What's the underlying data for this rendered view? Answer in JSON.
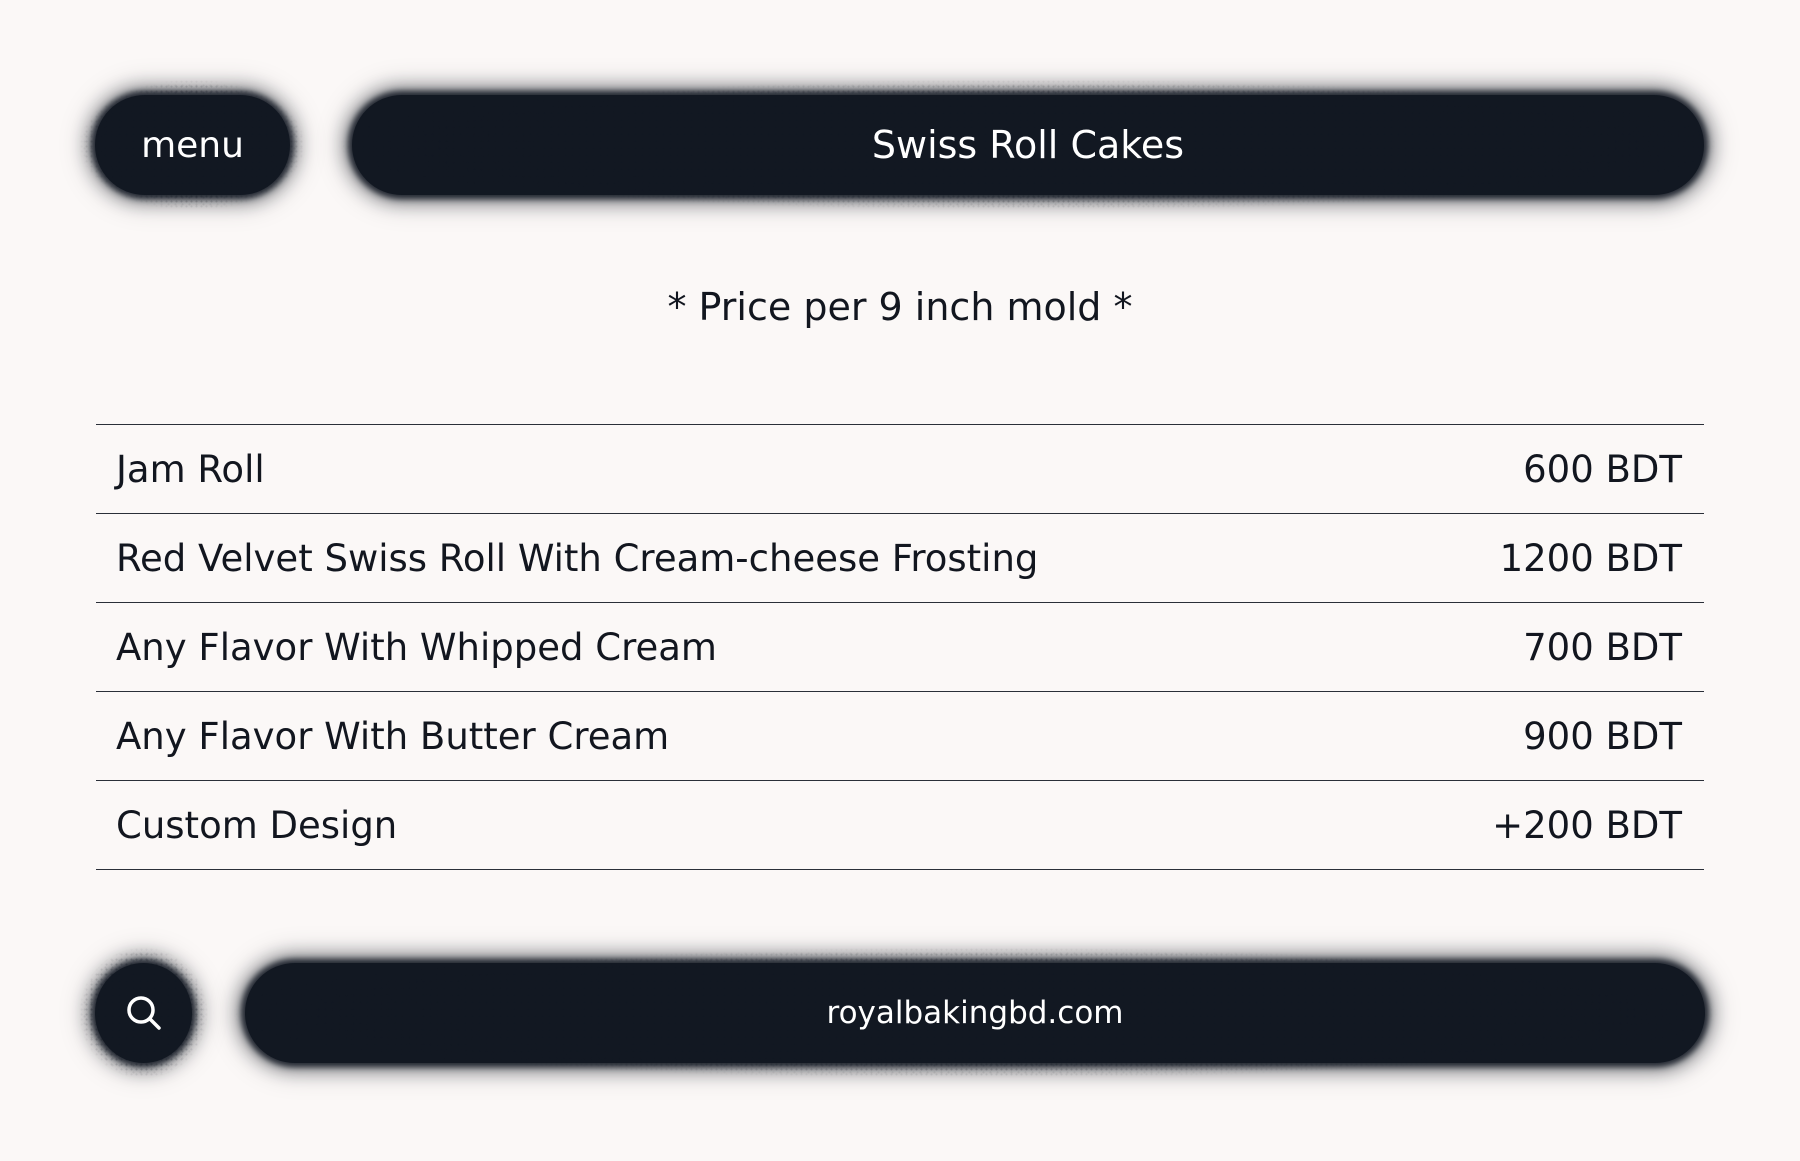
{
  "header": {
    "menu_label": "menu",
    "title": "Swiss Roll Cakes"
  },
  "note": "* Price per 9 inch mold *",
  "menu_items": [
    {
      "name": "Jam Roll",
      "price": "600 BDT"
    },
    {
      "name": "Red Velvet Swiss Roll With Cream-cheese Frosting",
      "price": "1200 BDT"
    },
    {
      "name": "Any Flavor With Whipped Cream",
      "price": "700 BDT"
    },
    {
      "name": "Any Flavor With Butter Cream",
      "price": "900 BDT"
    },
    {
      "name": "Custom Design",
      "price": "+200 BDT"
    }
  ],
  "footer": {
    "search_icon": "search-icon",
    "site": "royalbakingbd.com"
  },
  "colors": {
    "background": "#fbf8f7",
    "pill": "#121822",
    "text": "#12161f",
    "pill_text": "#ffffff"
  }
}
